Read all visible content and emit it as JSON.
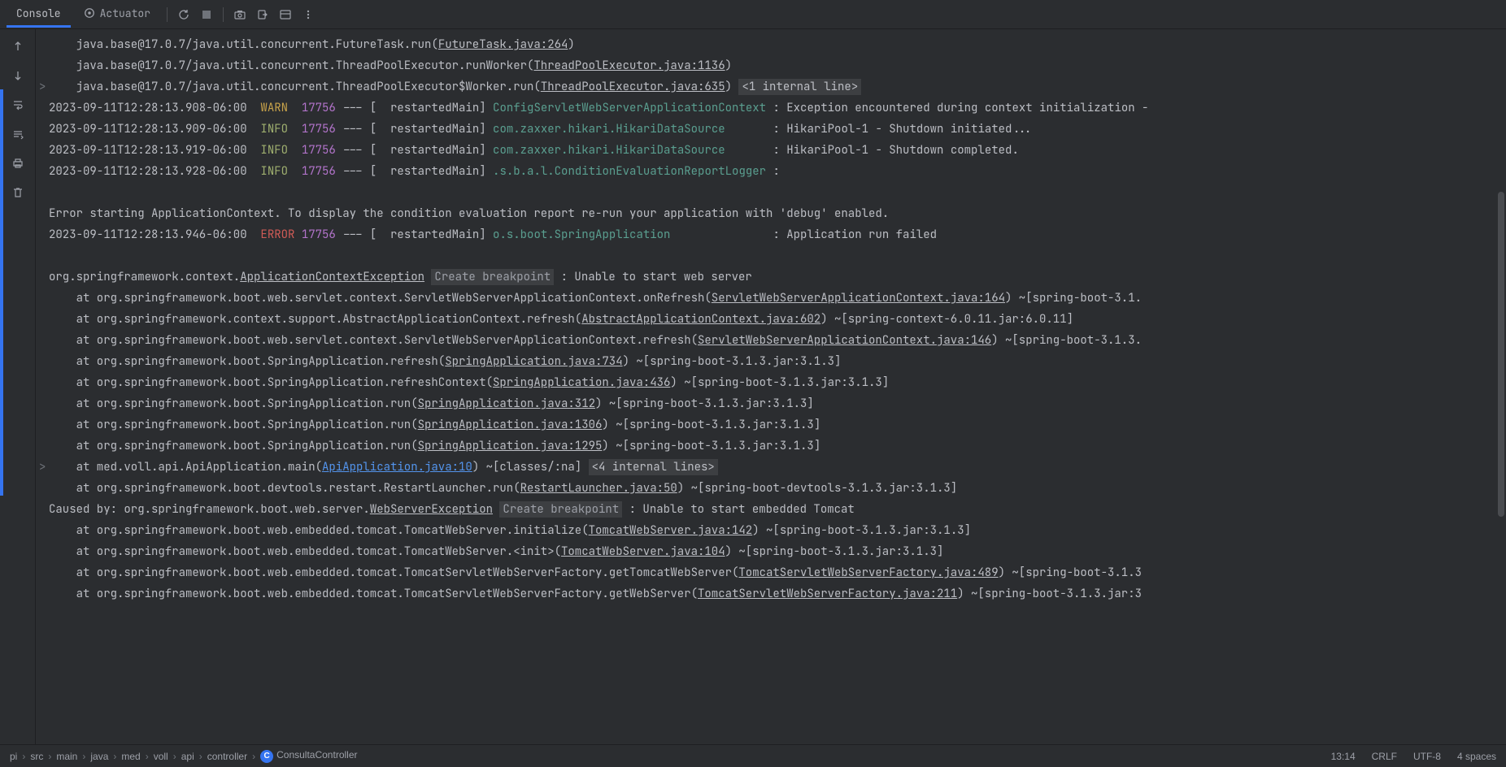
{
  "tabs": {
    "console": "Console",
    "actuator": "Actuator"
  },
  "console": {
    "stack_top": [
      {
        "prefix": "    java.base@17.0.7/java.util.concurrent.FutureTask.run(",
        "link": "FutureTask.java:264",
        "suffix": ")"
      },
      {
        "prefix": "    java.base@17.0.7/java.util.concurrent.ThreadPoolExecutor.runWorker(",
        "link": "ThreadPoolExecutor.java:1136",
        "suffix": ")"
      },
      {
        "prefix": "    java.base@17.0.7/java.util.concurrent.ThreadPoolExecutor$Worker.run(",
        "link": "ThreadPoolExecutor.java:635",
        "suffix": ")",
        "badge": "<1 internal line>",
        "chevron": true
      }
    ],
    "logs": [
      {
        "ts": "2023-09-11T12:28:13.908-06:00",
        "lvl": "WARN",
        "pid": "17756",
        "thread": "restartedMain",
        "logger": "ConfigServletWebServerApplicationContext",
        "msg": "Exception encountered during context initialization - "
      },
      {
        "ts": "2023-09-11T12:28:13.909-06:00",
        "lvl": "INFO",
        "pid": "17756",
        "thread": "restartedMain",
        "logger": "com.zaxxer.hikari.HikariDataSource",
        "msg": "HikariPool-1 - Shutdown initiated..."
      },
      {
        "ts": "2023-09-11T12:28:13.919-06:00",
        "lvl": "INFO",
        "pid": "17756",
        "thread": "restartedMain",
        "logger": "com.zaxxer.hikari.HikariDataSource",
        "msg": "HikariPool-1 - Shutdown completed."
      },
      {
        "ts": "2023-09-11T12:28:13.928-06:00",
        "lvl": "INFO",
        "pid": "17756",
        "thread": "restartedMain",
        "logger": ".s.b.a.l.ConditionEvaluationReportLogger",
        "msg": ""
      }
    ],
    "blank1": "",
    "err_ctx": "Error starting ApplicationContext. To display the condition evaluation report re-run your application with 'debug' enabled.",
    "log_err": {
      "ts": "2023-09-11T12:28:13.946-06:00",
      "lvl": "ERROR",
      "pid": "17756",
      "thread": "restartedMain",
      "logger": "o.s.boot.SpringApplication",
      "msg": "Application run failed"
    },
    "ex_head": {
      "prefix": "org.springframework.context.",
      "link": "ApplicationContextException",
      "bp": "Create breakpoint",
      "suffix": " : Unable to start web server"
    },
    "stack": [
      {
        "at": "    at org.springframework.boot.web.servlet.context.ServletWebServerApplicationContext.onRefresh(",
        "link": "ServletWebServerApplicationContext.java:164",
        "tail": ") ~[spring-boot-3.1."
      },
      {
        "at": "    at org.springframework.context.support.AbstractApplicationContext.refresh(",
        "link": "AbstractApplicationContext.java:602",
        "tail": ") ~[spring-context-6.0.11.jar:6.0.11]"
      },
      {
        "at": "    at org.springframework.boot.web.servlet.context.ServletWebServerApplicationContext.refresh(",
        "link": "ServletWebServerApplicationContext.java:146",
        "tail": ") ~[spring-boot-3.1.3."
      },
      {
        "at": "    at org.springframework.boot.SpringApplication.refresh(",
        "link": "SpringApplication.java:734",
        "tail": ") ~[spring-boot-3.1.3.jar:3.1.3]"
      },
      {
        "at": "    at org.springframework.boot.SpringApplication.refreshContext(",
        "link": "SpringApplication.java:436",
        "tail": ") ~[spring-boot-3.1.3.jar:3.1.3]"
      },
      {
        "at": "    at org.springframework.boot.SpringApplication.run(",
        "link": "SpringApplication.java:312",
        "tail": ") ~[spring-boot-3.1.3.jar:3.1.3]"
      },
      {
        "at": "    at org.springframework.boot.SpringApplication.run(",
        "link": "SpringApplication.java:1306",
        "tail": ") ~[spring-boot-3.1.3.jar:3.1.3]"
      },
      {
        "at": "    at org.springframework.boot.SpringApplication.run(",
        "link": "SpringApplication.java:1295",
        "tail": ") ~[spring-boot-3.1.3.jar:3.1.3]"
      },
      {
        "at": "    at med.voll.api.ApiApplication.main(",
        "link": "ApiApplication.java:10",
        "link_blue": true,
        "tail": ") ~[classes/:na]",
        "badge": "<4 internal lines>",
        "chevron": true
      },
      {
        "at": "    at org.springframework.boot.devtools.restart.RestartLauncher.run(",
        "link": "RestartLauncher.java:50",
        "tail": ") ~[spring-boot-devtools-3.1.3.jar:3.1.3]"
      }
    ],
    "caused": {
      "prefix": "Caused by: org.springframework.boot.web.server.",
      "link": "WebServerException",
      "bp": "Create breakpoint",
      "suffix": " : Unable to start embedded Tomcat"
    },
    "stack2": [
      {
        "at": "    at org.springframework.boot.web.embedded.tomcat.TomcatWebServer.initialize(",
        "link": "TomcatWebServer.java:142",
        "tail": ") ~[spring-boot-3.1.3.jar:3.1.3]"
      },
      {
        "at": "    at org.springframework.boot.web.embedded.tomcat.TomcatWebServer.<init>(",
        "link": "TomcatWebServer.java:104",
        "tail": ") ~[spring-boot-3.1.3.jar:3.1.3]"
      },
      {
        "at": "    at org.springframework.boot.web.embedded.tomcat.TomcatServletWebServerFactory.getTomcatWebServer(",
        "link": "TomcatServletWebServerFactory.java:489",
        "tail": ") ~[spring-boot-3.1.3"
      },
      {
        "at": "    at org.springframework.boot.web.embedded.tomcat.TomcatServletWebServerFactory.getWebServer(",
        "link": "TomcatServletWebServerFactory.java:211",
        "tail": ") ~[spring-boot-3.1.3.jar:3"
      }
    ]
  },
  "breadcrumb": [
    "pi",
    "src",
    "main",
    "java",
    "med",
    "voll",
    "api",
    "controller",
    "ConsultaController"
  ],
  "status": {
    "pos": "13:14",
    "sep": "CRLF",
    "enc": "UTF-8",
    "indent": "4 spaces"
  }
}
